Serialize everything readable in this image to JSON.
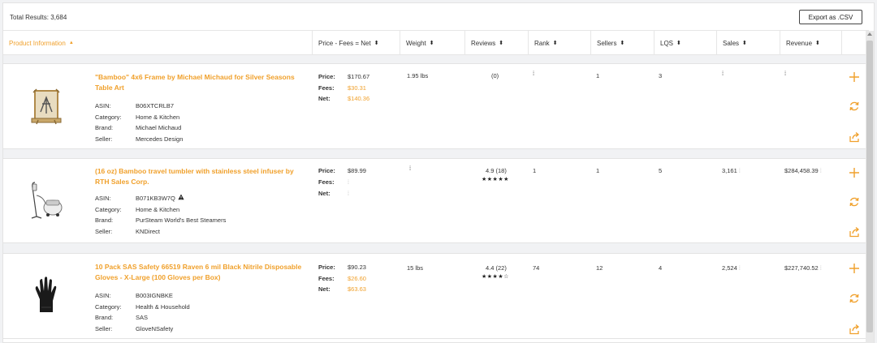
{
  "toolbar": {
    "total_results": "Total Results: 3,684",
    "export_label": "Export as .CSV"
  },
  "columns": {
    "product": "Product Information",
    "price": "Price - Fees = Net",
    "weight": "Weight",
    "reviews": "Reviews",
    "rank": "Rank",
    "sellers": "Sellers",
    "lqs": "LQS",
    "sales": "Sales",
    "revenue": "Revenue"
  },
  "labels": {
    "asin": "ASIN:",
    "category": "Category:",
    "brand": "Brand:",
    "seller": "Seller:",
    "price": "Price:",
    "fees": "Fees:",
    "net": "Net:"
  },
  "products": [
    {
      "title": "\"Bamboo\" 4x6 Frame by Michael Michaud for Silver Seasons Table Art",
      "asin": "B06XTCRLB7",
      "category": "Home & Kitchen",
      "brand": "Michael Michaud",
      "seller": "Mercedes Design",
      "price": "$170.67",
      "fees": "$30.31",
      "net": "$140.36",
      "weight": "1.95 lbs",
      "reviews": "(0)",
      "stars": "",
      "rank": "",
      "sellers": "1",
      "lqs": "3",
      "sales": "",
      "revenue": ""
    },
    {
      "title": "(16 oz) Bamboo travel tumbler with stainless steel infuser by RTH Sales Corp.",
      "asin": "B071KB3W7Q",
      "category": "Home & Kitchen",
      "brand": "PurSteam World's Best Steamers",
      "seller": "KNDirect",
      "price": "$89.99",
      "fees": "",
      "net": "",
      "weight": "",
      "reviews": "4.9 (18)",
      "stars": "★★★★★",
      "rank": "1",
      "sellers": "1",
      "lqs": "5",
      "sales": "3,161",
      "revenue": "$284,458.39"
    },
    {
      "title": "10 Pack SAS Safety 66519 Raven 6 mil Black Nitrile Disposable Gloves - X-Large (100 Gloves per Box)",
      "asin": "B003IGNBKE",
      "category": "Health & Household",
      "brand": "SAS",
      "seller": "GloveNSafety",
      "price": "$90.23",
      "fees": "$26.60",
      "net": "$63.63",
      "weight": "15 lbs",
      "reviews": "4.4 (22)",
      "stars": "★★★★☆",
      "rank": "74",
      "sellers": "12",
      "lqs": "4",
      "sales": "2,524",
      "revenue": "$227,740.52"
    }
  ],
  "icons": {
    "add": "plus-icon",
    "refresh": "refresh-icon",
    "share": "share-icon",
    "warning": "warning-icon",
    "sort": "sort-icon"
  },
  "colors": {
    "accent": "#f0a02b",
    "border": "#e3e3e3",
    "background": "#f1f2f4"
  }
}
